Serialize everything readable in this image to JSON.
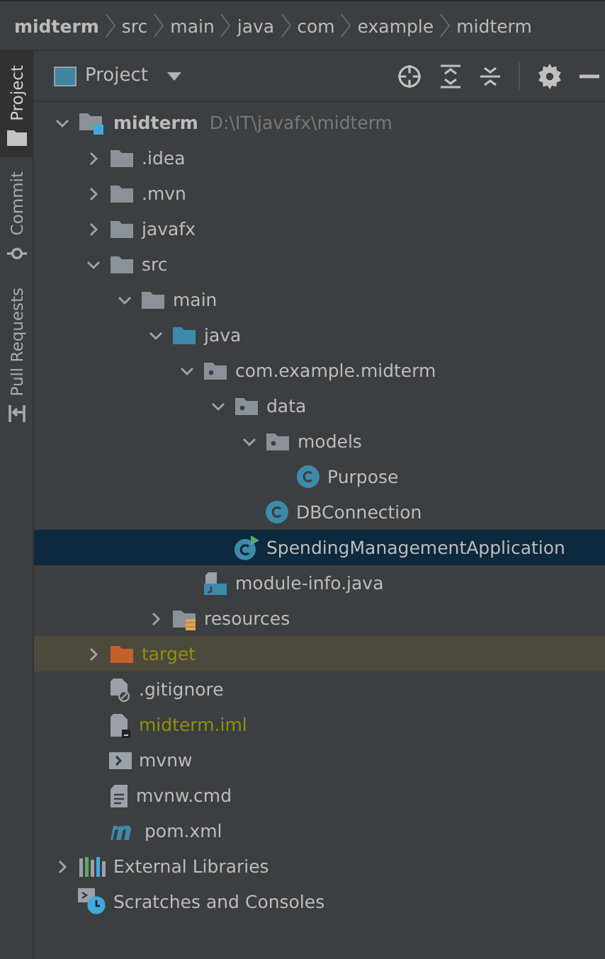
{
  "breadcrumbs": [
    {
      "label": "midterm",
      "bold": true
    },
    {
      "label": "src",
      "bold": false
    },
    {
      "label": "main",
      "bold": false
    },
    {
      "label": "java",
      "bold": false
    },
    {
      "label": "com",
      "bold": false
    },
    {
      "label": "example",
      "bold": false
    },
    {
      "label": "midterm",
      "bold": false
    }
  ],
  "side_tabs": [
    {
      "label": "Project",
      "selected": true,
      "kind": "project"
    },
    {
      "label": "Commit",
      "selected": false,
      "kind": "commit"
    },
    {
      "label": "Pull Requests",
      "selected": false,
      "kind": "pull"
    }
  ],
  "panel": {
    "title": "Project"
  },
  "tree": [
    {
      "kind": "module",
      "label": "midterm",
      "path": "D:\\IT\\javafx\\midterm",
      "expanded": true,
      "selected": false,
      "hovered": false,
      "ignored": false,
      "children": [
        {
          "kind": "folder",
          "label": ".idea",
          "expanded": false,
          "selected": false,
          "hovered": false,
          "ignored": false
        },
        {
          "kind": "folder",
          "label": ".mvn",
          "expanded": false,
          "selected": false,
          "hovered": false,
          "ignored": false
        },
        {
          "kind": "folder",
          "label": "javafx",
          "expanded": false,
          "selected": false,
          "hovered": false,
          "ignored": false
        },
        {
          "kind": "folder",
          "label": "src",
          "expanded": true,
          "selected": false,
          "hovered": false,
          "ignored": false,
          "children": [
            {
              "kind": "folder",
              "label": "main",
              "expanded": true,
              "selected": false,
              "hovered": false,
              "ignored": false,
              "children": [
                {
                  "kind": "source",
                  "label": "java",
                  "expanded": true,
                  "selected": false,
                  "hovered": false,
                  "ignored": false,
                  "children": [
                    {
                      "kind": "package",
                      "label": "com.example.midterm",
                      "expanded": true,
                      "selected": false,
                      "hovered": false,
                      "ignored": false,
                      "children": [
                        {
                          "kind": "package",
                          "label": "data",
                          "expanded": true,
                          "selected": false,
                          "hovered": false,
                          "ignored": false,
                          "children": [
                            {
                              "kind": "package",
                              "label": "models",
                              "expanded": true,
                              "selected": false,
                              "hovered": false,
                              "ignored": false,
                              "children": [
                                {
                                  "kind": "class",
                                  "label": "Purpose",
                                  "selected": false,
                                  "hovered": false,
                                  "ignored": false
                                }
                              ]
                            },
                            {
                              "kind": "class",
                              "label": "DBConnection",
                              "selected": false,
                              "hovered": false,
                              "ignored": false
                            }
                          ]
                        },
                        {
                          "kind": "main-class",
                          "label": "SpendingManagementApplication",
                          "selected": true,
                          "hovered": false,
                          "ignored": false
                        }
                      ]
                    },
                    {
                      "kind": "java-file",
                      "label": "module-info.java",
                      "selected": false,
                      "hovered": false,
                      "ignored": false
                    }
                  ]
                },
                {
                  "kind": "resources",
                  "label": "resources",
                  "expanded": false,
                  "selected": false,
                  "hovered": false,
                  "ignored": false
                }
              ]
            }
          ]
        },
        {
          "kind": "excluded",
          "label": "target",
          "expanded": false,
          "selected": false,
          "hovered": true,
          "ignored": true
        },
        {
          "kind": "gitignore",
          "label": ".gitignore",
          "selected": false,
          "hovered": false,
          "ignored": false
        },
        {
          "kind": "iml",
          "label": "midterm.iml",
          "selected": false,
          "hovered": false,
          "ignored": true
        },
        {
          "kind": "shell",
          "label": "mvnw",
          "selected": false,
          "hovered": false,
          "ignored": false
        },
        {
          "kind": "text",
          "label": "mvnw.cmd",
          "selected": false,
          "hovered": false,
          "ignored": false
        },
        {
          "kind": "maven",
          "label": "pom.xml",
          "selected": false,
          "hovered": false,
          "ignored": false
        }
      ]
    },
    {
      "kind": "libraries",
      "label": "External Libraries",
      "expanded": false,
      "selected": false,
      "hovered": false,
      "ignored": false
    },
    {
      "kind": "scratches",
      "label": "Scratches and Consoles",
      "selected": false,
      "hovered": false,
      "ignored": false
    }
  ]
}
